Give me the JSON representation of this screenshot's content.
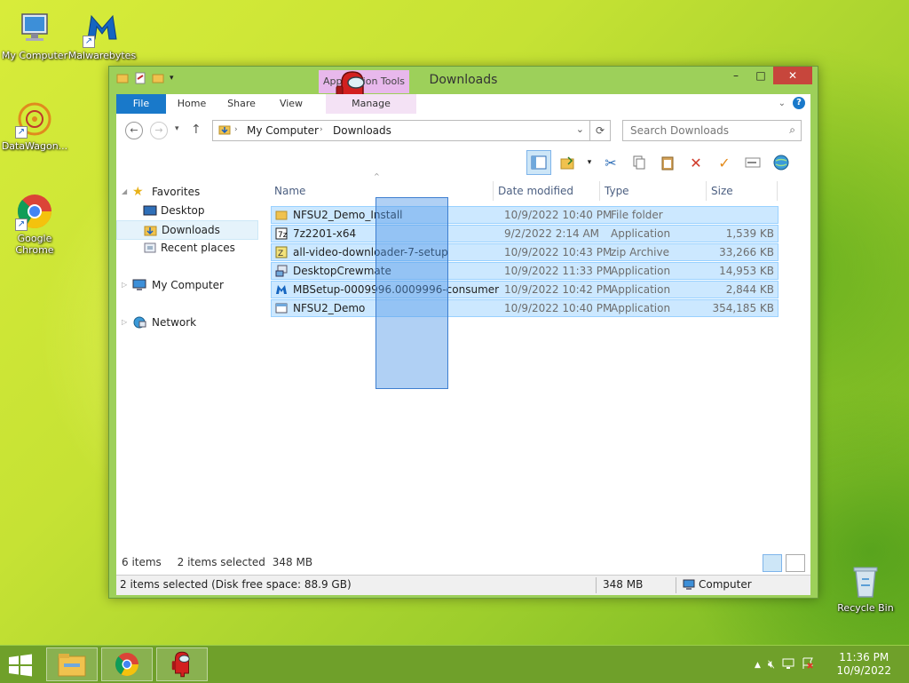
{
  "desktop": {
    "icons": [
      {
        "label": "My Computer"
      },
      {
        "label": "Malwarebytes"
      },
      {
        "label": "DataWagon..."
      },
      {
        "label": "Google Chrome"
      },
      {
        "label": "Recycle Bin"
      }
    ]
  },
  "window": {
    "title": "Downloads",
    "context_tab": "Application Tools",
    "context_subtab": "Manage",
    "tabs": {
      "file": "File",
      "home": "Home",
      "share": "Share",
      "view": "View"
    },
    "controls": {
      "minimize": "–",
      "maximize": "□",
      "close": "✕"
    },
    "help": "?"
  },
  "address": {
    "crumbs": [
      "My Computer",
      "Downloads"
    ],
    "search_placeholder": "Search Downloads"
  },
  "nav": {
    "favorites": "Favorites",
    "desktop": "Desktop",
    "downloads": "Downloads",
    "recent": "Recent places",
    "my_computer": "My Computer",
    "network": "Network"
  },
  "columns": {
    "name": "Name",
    "date": "Date modified",
    "type": "Type",
    "size": "Size"
  },
  "files": [
    {
      "name": "NFSU2_Demo_Install",
      "date": "10/9/2022 10:40 PM",
      "type": "File folder",
      "size": ""
    },
    {
      "name": "7z2201-x64",
      "date": "9/2/2022 2:14 AM",
      "type": "Application",
      "size": "1,539 KB"
    },
    {
      "name": "all-video-downloader-7-setup",
      "date": "10/9/2022 10:43 PM",
      "type": "zip Archive",
      "size": "33,266 KB"
    },
    {
      "name": "DesktopCrewmate",
      "date": "10/9/2022 11:33 PM",
      "type": "Application",
      "size": "14,953 KB"
    },
    {
      "name": "MBSetup-0009996.0009996-consumer",
      "date": "10/9/2022 10:42 PM",
      "type": "Application",
      "size": "2,844 KB"
    },
    {
      "name": "NFSU2_Demo",
      "date": "10/9/2022 10:40 PM",
      "type": "Application",
      "size": "354,185 KB"
    }
  ],
  "info": {
    "count": "6 items",
    "selected": "2 items selected",
    "selected_size": "348 MB"
  },
  "status": {
    "left": "2 items selected (Disk free space: 88.9 GB)",
    "size": "348 MB",
    "location": "Computer"
  },
  "clock": {
    "time": "11:36 PM",
    "date": "10/9/2022"
  },
  "colors": {
    "ribbon_blue": "#1979ca",
    "selection": "#cce8ff",
    "window_frame": "#9dd05a",
    "taskbar": "#6fa02a"
  }
}
